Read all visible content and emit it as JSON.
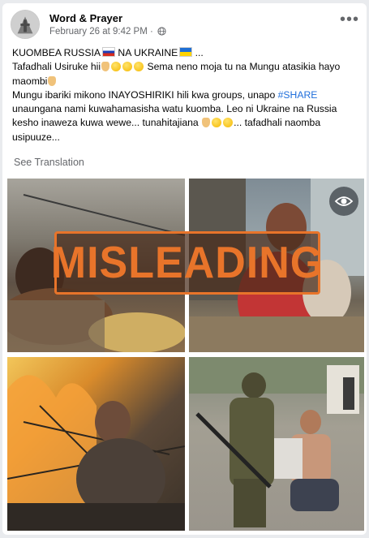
{
  "post": {
    "page_name": "Word & Prayer",
    "date": "February 26 at 9:42 PM",
    "separator": "·",
    "more_icon": "more-options-icon",
    "text": {
      "line1a": "KUOMBEA RUSSIA",
      "line1b": " NA UKRAINE",
      "line1c": " ...",
      "line2a": "Tafadhali Usiruke hii",
      "line2b": " Sema neno moja tu na Mungu atasikia hayo maombi",
      "line3a": "Mungu ibariki mikono INAYOSHIRIKI hili kwa groups, unapo ",
      "hashtag": "#SHARE",
      "line3b": " unaungana nami kuwahamasisha watu kuomba. Leo ni Ukraine na Russia kesho inaweza kuwa wewe... tunahitajiana ",
      "line3c": "... tafadhali naomba usipuuze..."
    },
    "see_translation": "See Translation",
    "label": "MISLEADING",
    "colors": {
      "stamp": "#e8742a",
      "link": "#216fdb",
      "secondary_text": "#65676b"
    }
  }
}
